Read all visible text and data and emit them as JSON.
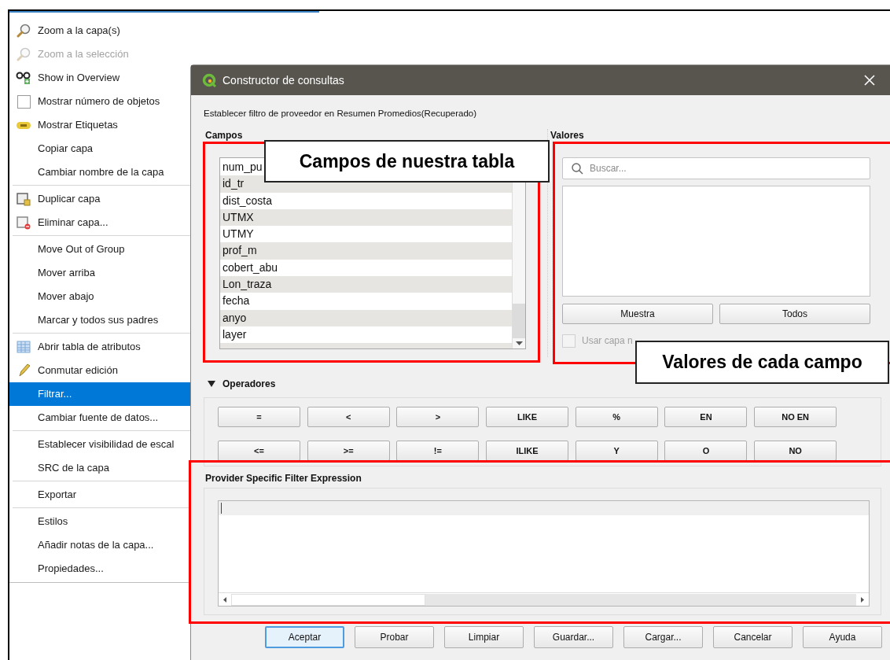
{
  "context_menu": {
    "groups": [
      [
        {
          "label": "Zoom a la capa(s)",
          "kind": "command",
          "disabled": false,
          "selected": false
        },
        {
          "label": "Zoom a la selección",
          "kind": "command",
          "disabled": true,
          "selected": false
        },
        {
          "label": "Show in Overview",
          "kind": "command",
          "disabled": false,
          "selected": false
        },
        {
          "label": "Mostrar número de objetos",
          "kind": "checkbox",
          "checked": false,
          "disabled": false,
          "selected": false
        },
        {
          "label": "Mostrar Etiquetas",
          "kind": "command",
          "disabled": false,
          "selected": false
        },
        {
          "label": "Copiar capa",
          "kind": "command",
          "disabled": false,
          "selected": false
        },
        {
          "label": "Cambiar nombre de la capa",
          "kind": "command",
          "disabled": false,
          "selected": false
        }
      ],
      [
        {
          "label": "Duplicar capa",
          "kind": "command",
          "disabled": false,
          "selected": false
        },
        {
          "label": "Eliminar capa...",
          "kind": "command",
          "disabled": false,
          "selected": false
        }
      ],
      [
        {
          "label": "Move Out of Group",
          "kind": "command",
          "disabled": false,
          "selected": false
        },
        {
          "label": "Mover arriba",
          "kind": "command",
          "disabled": false,
          "selected": false
        },
        {
          "label": "Mover abajo",
          "kind": "command",
          "disabled": false,
          "selected": false
        },
        {
          "label": "Marcar y todos sus padres",
          "kind": "command",
          "disabled": false,
          "selected": false
        }
      ],
      [
        {
          "label": "Abrir tabla de atributos",
          "kind": "command",
          "disabled": false,
          "selected": false
        },
        {
          "label": "Conmutar edición",
          "kind": "command",
          "disabled": false,
          "selected": false
        },
        {
          "label": "Filtrar...",
          "kind": "command",
          "disabled": false,
          "selected": true
        },
        {
          "label": "Cambiar fuente de datos...",
          "kind": "command",
          "disabled": false,
          "selected": false
        }
      ],
      [
        {
          "label": "Establecer visibilidad de escal",
          "kind": "command",
          "disabled": false,
          "selected": false
        },
        {
          "label": "SRC de la capa",
          "kind": "command",
          "disabled": false,
          "selected": false
        }
      ],
      [
        {
          "label": "Exportar",
          "kind": "command",
          "disabled": false,
          "selected": false
        }
      ],
      [
        {
          "label": "Estilos",
          "kind": "command",
          "disabled": false,
          "selected": false
        },
        {
          "label": "Añadir notas de la capa...",
          "kind": "command",
          "disabled": false,
          "selected": false
        },
        {
          "label": "Propiedades...",
          "kind": "command",
          "disabled": false,
          "selected": false
        }
      ]
    ]
  },
  "dialog": {
    "title": "Constructor de consultas",
    "subtitle": "Establecer filtro de proveedor en Resumen Promedios(Recuperado)",
    "fields": {
      "heading": "Campos",
      "items": [
        "num_pu",
        "id_tr",
        "dist_costa",
        "UTMX",
        "UTMY",
        "prof_m",
        "cobert_abu",
        "Lon_traza",
        "fecha",
        "anyo",
        "layer"
      ]
    },
    "values": {
      "heading": "Valores",
      "search_placeholder": "Buscar...",
      "buttons": [
        "Muestra",
        "Todos"
      ],
      "unfiltered_checkbox": {
        "label": "Usar capa n",
        "checked": false,
        "disabled": true
      }
    },
    "operators": {
      "heading": "Operadores",
      "expanded": true,
      "buttons": [
        "=",
        "<",
        ">",
        "LIKE",
        "%",
        "EN",
        "NO EN",
        "<=",
        ">=",
        "!=",
        "ILIKE",
        "Y",
        "O",
        "NO"
      ]
    },
    "expression": {
      "heading": "Provider Specific Filter Expression"
    },
    "buttons": [
      {
        "label": "Aceptar",
        "default": true
      },
      {
        "label": "Probar",
        "default": false
      },
      {
        "label": "Limpiar",
        "default": false
      },
      {
        "label": "Guardar...",
        "default": false
      },
      {
        "label": "Cargar...",
        "default": false
      },
      {
        "label": "Cancelar",
        "default": false
      },
      {
        "label": "Ayuda",
        "default": false
      }
    ]
  },
  "annotations": [
    {
      "text": "Campos de nuestra tabla"
    },
    {
      "text": "Valores de cada campo"
    }
  ]
}
